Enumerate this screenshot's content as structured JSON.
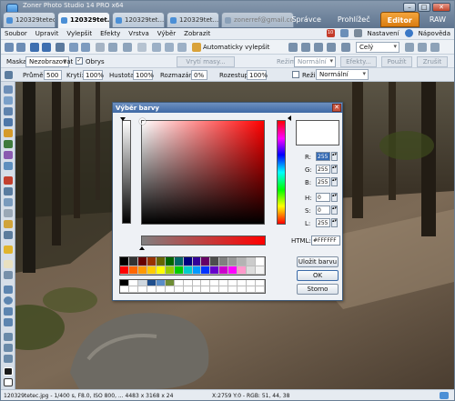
{
  "app": {
    "title": "Zoner Photo Studio 14 PRO x64"
  },
  "tabs": [
    {
      "label": "120329tetec",
      "state": "normal"
    },
    {
      "label": "120329tet...",
      "state": "active"
    },
    {
      "label": "120329tet...",
      "state": "normal"
    },
    {
      "label": "120329tet...",
      "state": "normal"
    },
    {
      "label": "zonerref@gmail.com",
      "state": "dim"
    }
  ],
  "modes": [
    "Správce",
    "Prohlížeč",
    "Editor",
    "RAW"
  ],
  "active_mode": "Editor",
  "notification_count": "10",
  "menu": [
    "Soubor",
    "Upravit",
    "Vylepšit",
    "Efekty",
    "Vrstva",
    "Výběr",
    "Zobrazit"
  ],
  "menu_right": {
    "settings": "Nastavení",
    "help": "Nápověda"
  },
  "toolbar": {
    "autofix": "Automaticky vylepšit",
    "zoom": "Celý"
  },
  "mask_bar": {
    "mask_label": "Maska:",
    "mask_value": "Nezobrazovat",
    "outline_label": "Obrys",
    "outline_checked": true,
    "mode_label": "Režim:",
    "mode_value": "Normální",
    "disabled_1": "Vrytí masy...",
    "disabled_2": "Efekty...",
    "disabled_3": "Použít",
    "disabled_4": "Zrušit"
  },
  "brush_bar": {
    "diameter_label": "Průměr:",
    "diameter_value": "500",
    "opacity_label": "Krytí:",
    "opacity_value": "100%",
    "density_label": "Hustota:",
    "density_value": "100%",
    "blur_label": "Rozmazání:",
    "blur_value": "0%",
    "spread_label": "Rozestup:",
    "spread_value": "100%",
    "mode_label": "Režim:",
    "mode_value": "Normální"
  },
  "dialog": {
    "title": "Výběr barvy",
    "fields": [
      {
        "label": "R:",
        "value": "255"
      },
      {
        "label": "G:",
        "value": "255"
      },
      {
        "label": "B:",
        "value": "255"
      },
      {
        "label": "H:",
        "value": "0"
      },
      {
        "label": "S:",
        "value": "0"
      },
      {
        "label": "L:",
        "value": "255"
      }
    ],
    "html_label": "HTML:",
    "html_value": "#FFFFFF",
    "save_button": "Uložit barvu",
    "ok_button": "OK",
    "cancel_button": "Storno",
    "current_color": "#ffffff",
    "palette_row1": [
      "#000000",
      "#333333",
      "#660000",
      "#993300",
      "#666600",
      "#006600",
      "#006666",
      "#000080",
      "#330099",
      "#660066",
      "#4d4d4d",
      "#808080",
      "#999999",
      "#b3b3b3",
      "#cccccc",
      "#ffffff"
    ],
    "palette_row2": [
      "#ff0000",
      "#ff6600",
      "#ff9900",
      "#ffcc00",
      "#ffff00",
      "#99cc00",
      "#00cc00",
      "#00cccc",
      "#0099ff",
      "#0033ff",
      "#6600cc",
      "#cc00cc",
      "#ff00ff",
      "#ff99cc",
      "#dddddd",
      "#f4f4f4"
    ],
    "custom_row1": [
      "#000000",
      "#ffffff",
      "#cfd7df",
      "#1f4e8c",
      "#5a8dc7",
      "#6e8d34",
      "#ffffff",
      "#ffffff",
      "#ffffff",
      "#ffffff",
      "#ffffff",
      "#ffffff",
      "#ffffff",
      "#ffffff",
      "#ffffff",
      "#ffffff"
    ]
  },
  "status": {
    "file": "120329tetec.jpg - 1/400 s, F8.0, ISO 800, ... 4483 x 3168 x 24",
    "coords": "X:2759 Y:0 - RGB: 51, 44, 38"
  }
}
